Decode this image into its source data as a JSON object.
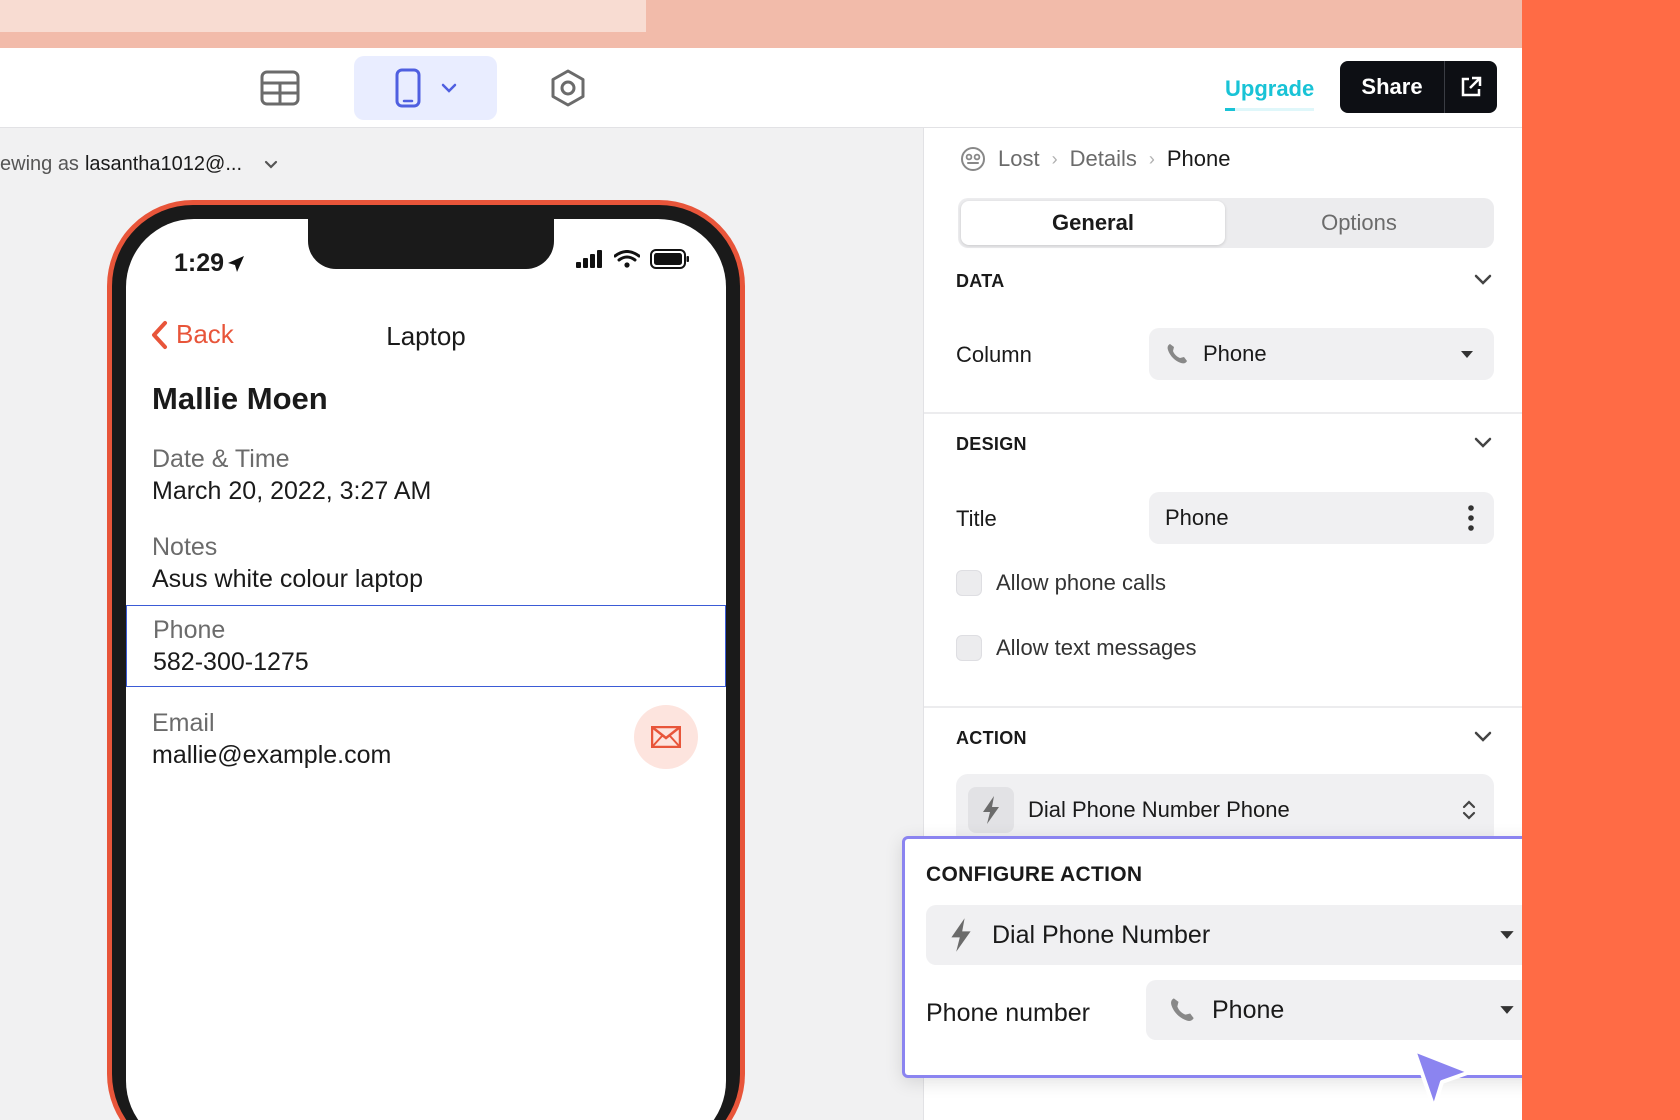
{
  "toolbar": {
    "upgrade_label": "Upgrade",
    "share_label": "Share"
  },
  "viewing": {
    "prefix": "ewing as",
    "user": "lasantha1012@..."
  },
  "phone": {
    "time": "1:29",
    "back_label": "Back",
    "screen_title": "Laptop",
    "record_name": "Mallie Moen",
    "fields": [
      {
        "label": "Date & Time",
        "value": "March 20, 2022, 3:27 AM"
      },
      {
        "label": "Notes",
        "value": "Asus white colour laptop"
      },
      {
        "label": "Phone",
        "value": "582-300-1275"
      },
      {
        "label": "Email",
        "value": "mallie@example.com"
      }
    ]
  },
  "panel": {
    "breadcrumb": [
      "Lost",
      "Details",
      "Phone"
    ],
    "tabs": [
      "General",
      "Options"
    ],
    "data_section": {
      "heading": "DATA",
      "column_label": "Column",
      "column_value": "Phone"
    },
    "design_section": {
      "heading": "DESIGN",
      "title_label": "Title",
      "title_value": "Phone",
      "allow_calls": "Allow phone calls",
      "allow_texts": "Allow text messages"
    },
    "action_section": {
      "heading": "ACTION",
      "action_value": "Dial Phone Number Phone"
    }
  },
  "configure": {
    "title": "CONFIGURE ACTION",
    "action_value": "Dial Phone Number",
    "phone_label": "Phone number",
    "phone_value": "Phone"
  },
  "colors": {
    "brand_orange": "#ff6b45",
    "accent_blue": "#3b5bd6",
    "upgrade_cyan": "#19c3d6",
    "popup_border": "#8b84f0"
  }
}
